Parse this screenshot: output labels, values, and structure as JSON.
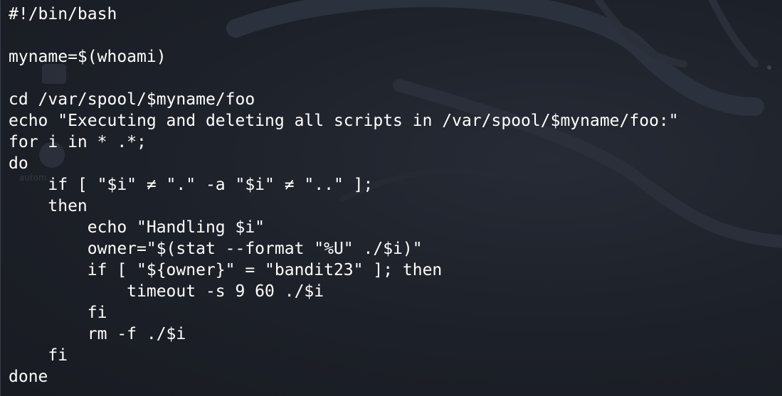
{
  "terminal": {
    "lines": [
      "#!/bin/bash",
      "",
      "myname=$(whoami)",
      "",
      "cd /var/spool/$myname/foo",
      "echo \"Executing and deleting all scripts in /var/spool/$myname/foo:\"",
      "for i in * .*;",
      "do",
      "    if [ \"$i\" ≠ \".\" -a \"$i\" ≠ \"..\" ];",
      "    then",
      "        echo \"Handling $i\"",
      "        owner=\"$(stat --format \"%U\" ./$i)\"",
      "        if [ \"${owner}\" = \"bandit23\" ]; then",
      "            timeout -s 9 60 ./$i",
      "        fi",
      "        rm -f ./$i",
      "    fi",
      "done"
    ]
  },
  "colors": {
    "background": "#1c2028",
    "text": "#ffffff"
  }
}
